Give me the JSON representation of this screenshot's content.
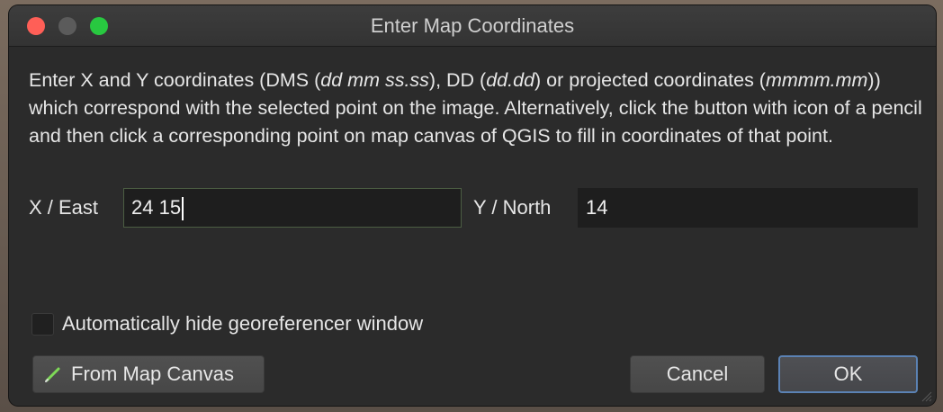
{
  "window": {
    "title": "Enter Map Coordinates"
  },
  "description": {
    "text_1": "Enter X and Y coordinates (DMS (",
    "em_1": "dd mm ss.ss",
    "text_2": "), DD (",
    "em_2": "dd.dd",
    "text_3": ") or projected coordinates (",
    "em_3": "mmmm.mm",
    "text_4": ")) which correspond with the selected point on the image. Alternatively, click the button with icon of a pencil and then click a corresponding point on map canvas of QGIS to fill in coordinates of that point."
  },
  "fields": {
    "x_label": "X / East",
    "x_value": "24 15",
    "y_label": "Y / North",
    "y_value": "14"
  },
  "checkbox": {
    "label": "Automatically hide georeferencer window",
    "checked": false
  },
  "buttons": {
    "from_map_canvas": "From Map Canvas",
    "cancel": "Cancel",
    "ok": "OK"
  },
  "icons": {
    "pencil": "pencil-icon",
    "close": "close-icon",
    "minimize": "minimize-icon",
    "maximize": "maximize-icon"
  },
  "colors": {
    "close": "#ff5f57",
    "maximize": "#28c840",
    "ok_border": "#5b82b4",
    "pencil": "#7ed957"
  }
}
